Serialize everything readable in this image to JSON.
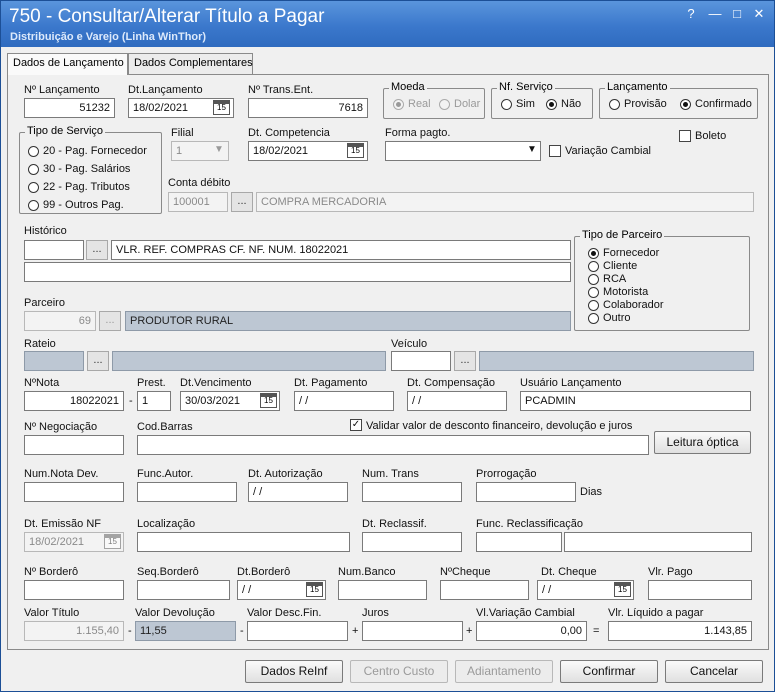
{
  "window": {
    "title": "750 - Consultar/Alterar Título a Pagar",
    "subtitle": "Distribuição e Varejo (Linha WinThor)"
  },
  "tabs": [
    {
      "label": "Dados de Lançamento"
    },
    {
      "label": "Dados Complementares"
    }
  ],
  "fields": {
    "n_lancamento": {
      "label": "Nº Lançamento",
      "value": "51232"
    },
    "dt_lancamento": {
      "label": "Dt.Lançamento",
      "value": "18/02/2021"
    },
    "n_trans_ent": {
      "label": "Nº Trans.Ent.",
      "value": "7618"
    },
    "filial": {
      "label": "Filial",
      "value": "1"
    },
    "dt_competencia": {
      "label": "Dt. Competencia",
      "value": "18/02/2021"
    },
    "forma_pagto": {
      "label": "Forma pagto.",
      "value": ""
    },
    "conta_debito": {
      "label": "Conta débito",
      "code": "100001",
      "desc": "COMPRA MERCADORIA"
    },
    "historico": {
      "label": "Histórico",
      "code": "",
      "text": "VLR. REF. COMPRAS CF. NF. NUM. 18022021",
      "text2": ""
    },
    "parceiro": {
      "label": "Parceiro",
      "code": "69",
      "desc": "PRODUTOR RURAL"
    },
    "rateio": {
      "label": "Rateio"
    },
    "veiculo": {
      "label": "Veículo"
    },
    "n_nota": {
      "label": "NºNota",
      "value": "18022021"
    },
    "prest": {
      "label": "Prest.",
      "value": "1"
    },
    "dt_vencimento": {
      "label": "Dt.Vencimento",
      "value": "30/03/2021"
    },
    "dt_pagamento": {
      "label": "Dt. Pagamento",
      "value": "/ /"
    },
    "dt_compensacao": {
      "label": "Dt. Compensação",
      "value": "/ /"
    },
    "usuario_lancamento": {
      "label": "Usuário Lançamento",
      "value": "PCADMIN"
    },
    "n_negociacao": {
      "label": "Nº Negociação",
      "value": ""
    },
    "cod_barras": {
      "label": "Cod.Barras",
      "value": ""
    },
    "num_nota_dev": {
      "label": "Num.Nota Dev.",
      "value": ""
    },
    "func_autor": {
      "label": "Func.Autor.",
      "value": ""
    },
    "dt_autorizacao": {
      "label": "Dt. Autorização",
      "value": "/ /"
    },
    "num_trans": {
      "label": "Num. Trans",
      "value": ""
    },
    "prorrogacao": {
      "label": "Prorrogação",
      "value": "",
      "unit": "Dias"
    },
    "dt_emissao_nf": {
      "label": "Dt. Emissão NF",
      "value": "18/02/2021"
    },
    "localizacao": {
      "label": "Localização",
      "value": ""
    },
    "dt_reclassif": {
      "label": "Dt. Reclassif.",
      "value": ""
    },
    "func_reclassificacao": {
      "label": "Func. Reclassificação",
      "value": ""
    },
    "n_bordero": {
      "label": "Nº Borderô",
      "value": ""
    },
    "seq_bordero": {
      "label": "Seq.Borderô",
      "value": ""
    },
    "dt_bordero": {
      "label": "Dt.Borderô",
      "value": "/ /"
    },
    "num_banco": {
      "label": "Num.Banco",
      "value": ""
    },
    "n_cheque": {
      "label": "NºCheque",
      "value": ""
    },
    "dt_cheque": {
      "label": "Dt. Cheque",
      "value": "/ /"
    },
    "vlr_pago": {
      "label": "Vlr. Pago",
      "value": ""
    },
    "valor_titulo": {
      "label": "Valor Título",
      "value": "1.155,40"
    },
    "valor_devolucao": {
      "label": "Valor Devolução",
      "value": "11,55"
    },
    "valor_desc_fin": {
      "label": "Valor Desc.Fin.",
      "value": ""
    },
    "juros": {
      "label": "Juros",
      "value": ""
    },
    "vl_variacao_cambial": {
      "label": "Vl.Variação Cambial",
      "value": "0,00"
    },
    "vlr_liquido": {
      "label": "Vlr. Líquido a pagar",
      "value": "1.143,85"
    }
  },
  "calendar_icon": "15",
  "ops": {
    "minus": "-",
    "plus": "+",
    "equals": "="
  },
  "groups": {
    "moeda": {
      "title": "Moeda",
      "options": [
        "Real",
        "Dolar"
      ],
      "selected": "Real"
    },
    "nf_servico": {
      "title": "Nf. Serviço",
      "options": [
        "Sim",
        "Não"
      ],
      "selected": "Não"
    },
    "lancamento": {
      "title": "Lançamento",
      "options": [
        "Provisão",
        "Confirmado"
      ],
      "selected": "Confirmado"
    },
    "tipo_servico": {
      "title": "Tipo de Serviço",
      "options": [
        "20 - Pag. Fornecedor",
        "30 - Pag. Salários",
        "22 - Pag. Tributos",
        "99 - Outros Pag."
      ]
    },
    "tipo_parceiro": {
      "title": "Tipo de Parceiro",
      "options": [
        "Fornecedor",
        "Cliente",
        "RCA",
        "Motorista",
        "Colaborador",
        "Outro"
      ],
      "selected": "Fornecedor"
    }
  },
  "checks": {
    "boleto": {
      "label": "Boleto",
      "checked": false
    },
    "variacao_cambial": {
      "label": "Variação Cambial",
      "checked": false
    },
    "validar_desconto": {
      "label": "Validar valor de desconto financeiro,  devolução e juros",
      "checked": true
    }
  },
  "buttons": {
    "dots": "...",
    "leitura_optica": "Leitura óptica",
    "dados_reinf": "Dados ReInf",
    "centro_custo": "Centro Custo",
    "adiantamento": "Adiantamento",
    "confirmar": "Confirmar",
    "cancelar": "Cancelar"
  },
  "window_buttons": {
    "help": "?",
    "minimize": "—",
    "maximize": "□",
    "close": "✕"
  }
}
